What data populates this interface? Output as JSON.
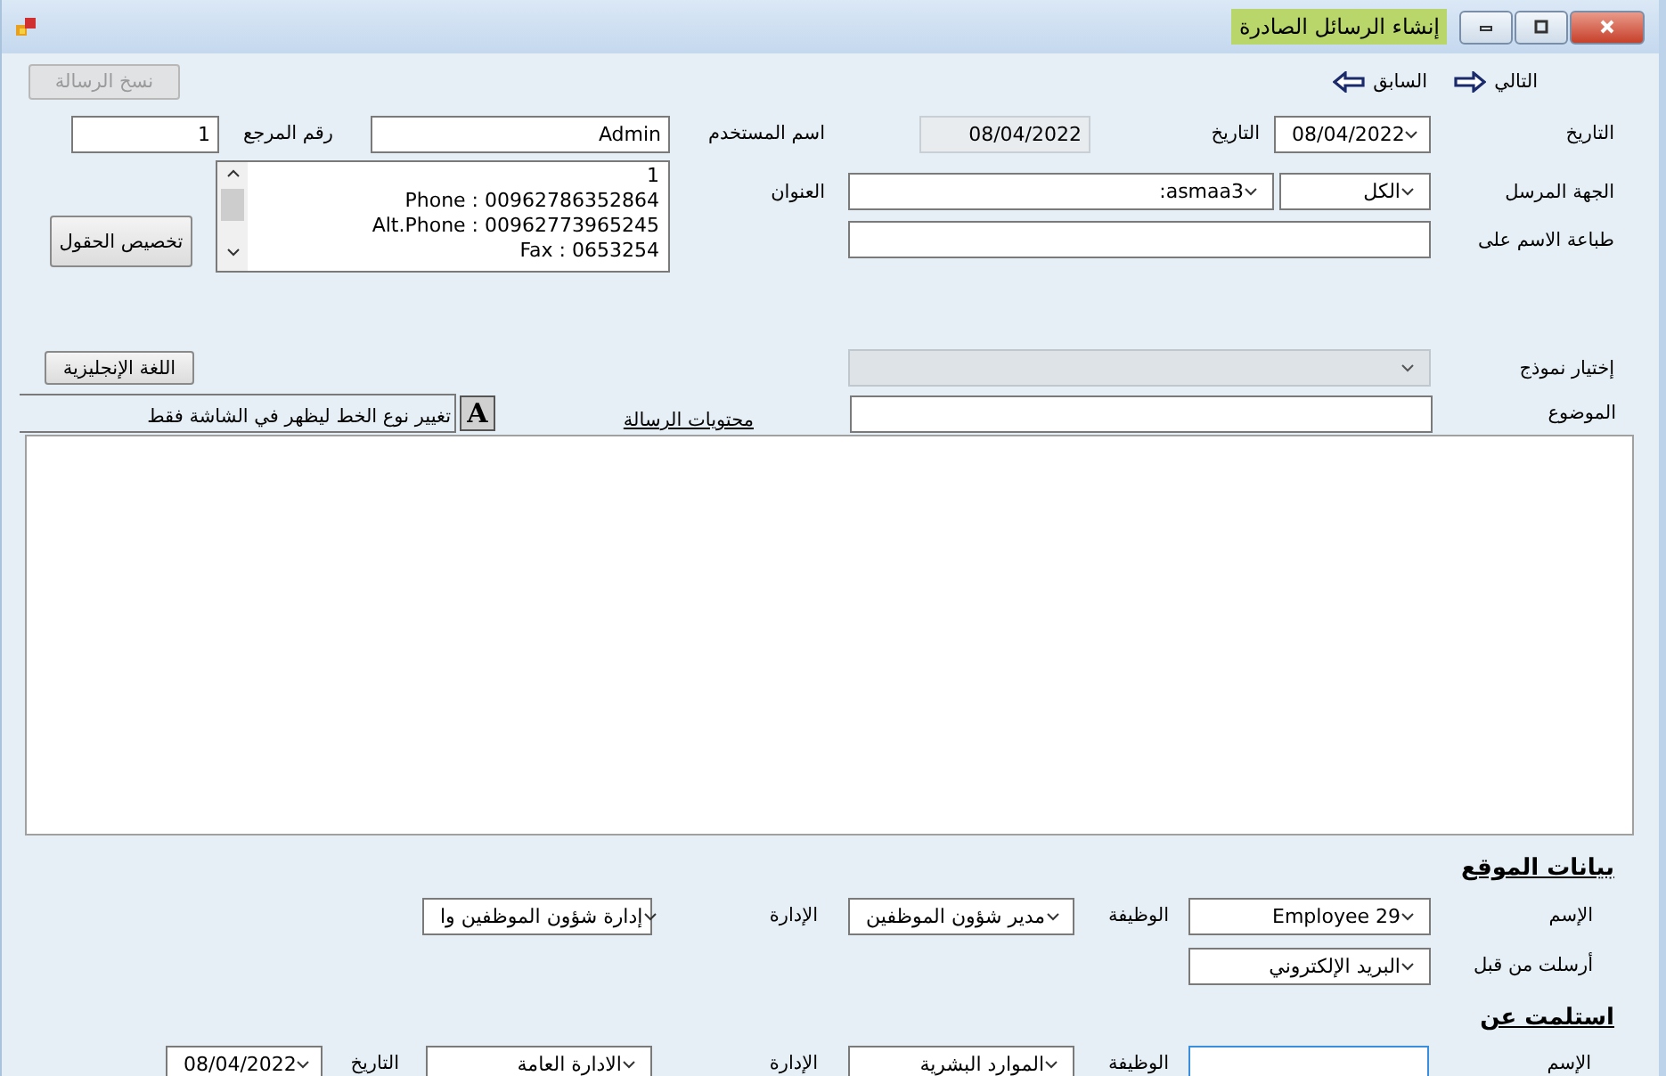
{
  "window": {
    "title": "إنشاء الرسائل الصادرة"
  },
  "toolbar": {
    "copy_button": {
      "label": "نسخ الرسالة",
      "disabled": true
    },
    "previous": "السابق",
    "next": "التالي"
  },
  "header": {
    "ref_label": "رقم المرجع",
    "ref": "1",
    "user_label": "اسم المستخدم",
    "user": "Admin",
    "entry_date": {
      "value": "08/04/2022",
      "readonly": true
    },
    "entry_date_label": "التاريخ",
    "date": "08/04/2022",
    "date_label": "التاريخ"
  },
  "sender": {
    "customize_button": "تخصيص الحقول",
    "address_lines": [
      "1",
      "Phone : 00962786352864",
      "Alt.Phone : 00962773965245",
      "Fax : 0653254"
    ],
    "address_label": "العنوان",
    "contact": "asmaa3:",
    "filter": "الكل",
    "label": "الجهة المرسل",
    "print_label": "طباعة الاسم على"
  },
  "template": {
    "english_button": "اللغة الإنجليزية",
    "disabled": true,
    "label": "إختيار نموذج"
  },
  "subject": {
    "font_note": "تغيير نوع الخط ليظهر في الشاشة فقط",
    "font_button": "A",
    "content_link": "محتويات الرسالة",
    "label": "الموضوع"
  },
  "signer": {
    "title": "بيانات الموقع",
    "dept": "إدارة شؤون الموظفين وا",
    "dept_label": "الإدارة",
    "job": "مدير شؤون الموظفين",
    "job_label": "الوظيفة",
    "name": "Employee 29",
    "name_label": "الإسم",
    "sent_by": "البريد الإلكتروني",
    "sent_by_label": "أرسلت من قبل"
  },
  "received": {
    "title": "استلمت عن",
    "date": "08/04/2022",
    "date_label": "التاريخ",
    "dept": "الادارة العامة",
    "dept_label": "الإدارة",
    "job": "الموارد البشرية",
    "job_label": "الوظيفة",
    "name_focused": true,
    "name_label": "الإسم"
  }
}
